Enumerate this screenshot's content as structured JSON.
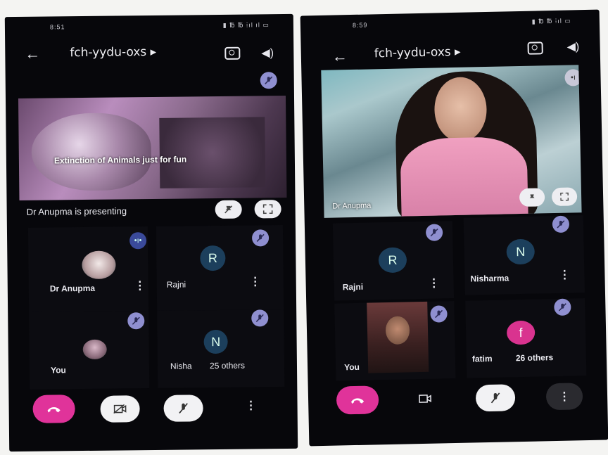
{
  "left": {
    "status": {
      "time": "8:51",
      "system": "▮ ℔ ℔ ⁞ıl ıl ▭"
    },
    "meeting_code": "fch-yydu-oxs ▸",
    "presentation_caption": "Extinction of Animals just for fun",
    "presenting_text": "Dr Anupma is presenting",
    "participants": [
      {
        "name": "Dr Anupma",
        "avatar": "photo"
      },
      {
        "name": "Rajni",
        "avatar": "R"
      },
      {
        "name": "You",
        "avatar": "photo"
      },
      {
        "name": "Nisha",
        "avatar": "N"
      }
    ],
    "others_text": "25 others"
  },
  "right": {
    "status": {
      "time": "8:59",
      "system": "▮ ℔ ℔ ⁞ıl ▭"
    },
    "meeting_code": "fch-yydu-oxs ▸",
    "main_speaker_label": "Dr Anupma",
    "participants": [
      {
        "name": "Rajni",
        "avatar": "R"
      },
      {
        "name": "Nisharma",
        "avatar": "N"
      },
      {
        "name": "You",
        "avatar": "photo"
      },
      {
        "name": "fatim",
        "avatar": "f"
      }
    ],
    "others_text": "26 others"
  },
  "colors": {
    "end_call": "#e0339a",
    "avatar_blue": "#1c3f5c",
    "avatar_pink": "#d9338f",
    "mute_badge": "#8f8fd0",
    "background": "#07070b"
  },
  "icons": [
    "back-arrow-icon",
    "camera-switch-icon",
    "speaker-icon",
    "mic-off-icon",
    "fullscreen-icon",
    "end-call-icon",
    "video-off-icon",
    "more-vert-icon",
    "video-icon",
    "audio-level-icon"
  ]
}
